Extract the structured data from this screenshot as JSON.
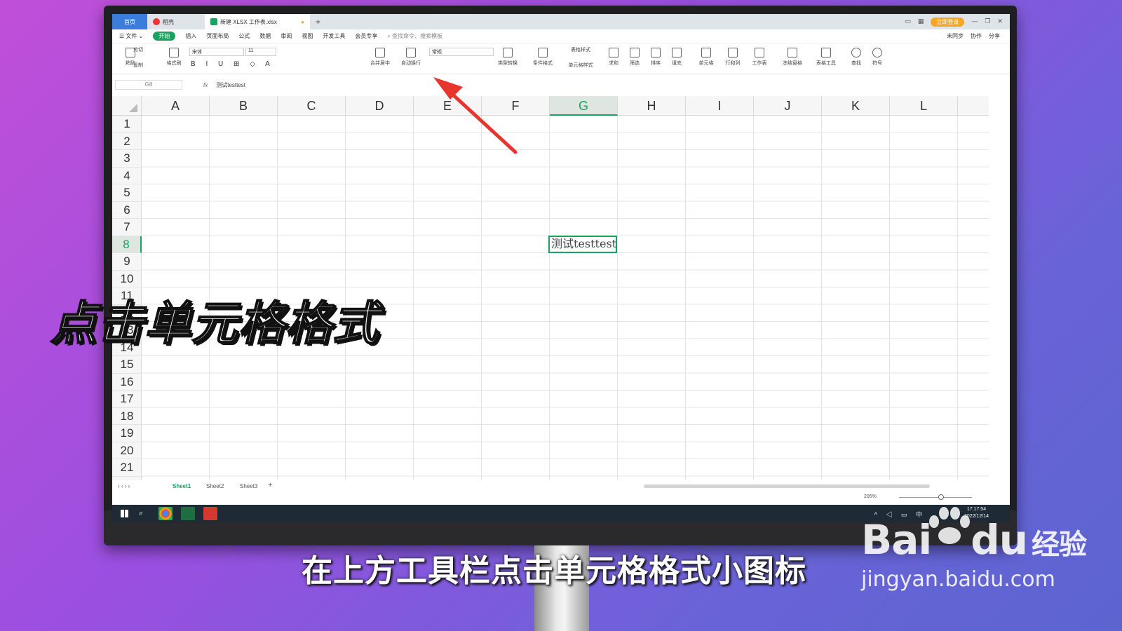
{
  "titlebar": {
    "tabs": [
      {
        "label": "首页"
      },
      {
        "label": "稻壳"
      },
      {
        "label": "新建 XLSX 工作表.xlsx"
      }
    ],
    "new_tab": "+",
    "login_label": "立即登录"
  },
  "menu": {
    "file": "☰ 文件 ⌄",
    "items": [
      "开始",
      "插入",
      "页面布局",
      "公式",
      "数据",
      "审阅",
      "视图",
      "开发工具",
      "会员专享"
    ],
    "search": "查找命令、搜索模板",
    "right": [
      "未同步",
      "协作",
      "分享"
    ]
  },
  "ribbon": {
    "paste": "粘贴",
    "cut": "剪切",
    "copy": "复制",
    "format_painter": "格式刷",
    "font": "宋体",
    "size": "11",
    "merge": "合并居中",
    "wrap": "自动换行",
    "number_format": "常规",
    "convert": "类型转换",
    "conditional": "条件格式",
    "table_style": "表格样式",
    "cell_style": "单元格样式",
    "sum": "求和",
    "filter": "筛选",
    "sort": "排序",
    "fill": "填充",
    "cell": "单元格",
    "row_col": "行和列",
    "worksheet": "工作表",
    "freeze": "冻结窗格",
    "table_tools": "表格工具",
    "find": "查找",
    "symbol": "符号"
  },
  "formula_bar": {
    "name_box": "G8",
    "fx": "fx",
    "value": "测试testtest"
  },
  "grid": {
    "columns": [
      "A",
      "B",
      "C",
      "D",
      "E",
      "F",
      "G",
      "H",
      "I",
      "J",
      "K",
      "L"
    ],
    "rows": [
      "1",
      "2",
      "3",
      "4",
      "5",
      "6",
      "7",
      "8",
      "9",
      "10",
      "11",
      "12",
      "13",
      "14",
      "15",
      "16",
      "17",
      "18",
      "19",
      "20",
      "21"
    ],
    "selected_column": "G",
    "selected_row": "8",
    "cell_text": "测试testtest"
  },
  "sheets": [
    "Sheet1",
    "Sheet2",
    "Sheet3"
  ],
  "add_sheet": "+",
  "status": {
    "zoom": "205%"
  },
  "taskbar": {
    "time": "17:17:54",
    "date": "2022/12/14",
    "ime": "中"
  },
  "overlay": {
    "big_caption": "点击单元格格式",
    "subtitle": "在上方工具栏点击单元格格式小图标",
    "watermark_brand": "Bai",
    "watermark_brand_tail": "du",
    "watermark_jy": "经验",
    "watermark_url": "jingyan.baidu.com"
  },
  "colors": {
    "accent": "#1aa260",
    "arrow": "#e8362f",
    "home_tab": "#3b7ddd"
  }
}
